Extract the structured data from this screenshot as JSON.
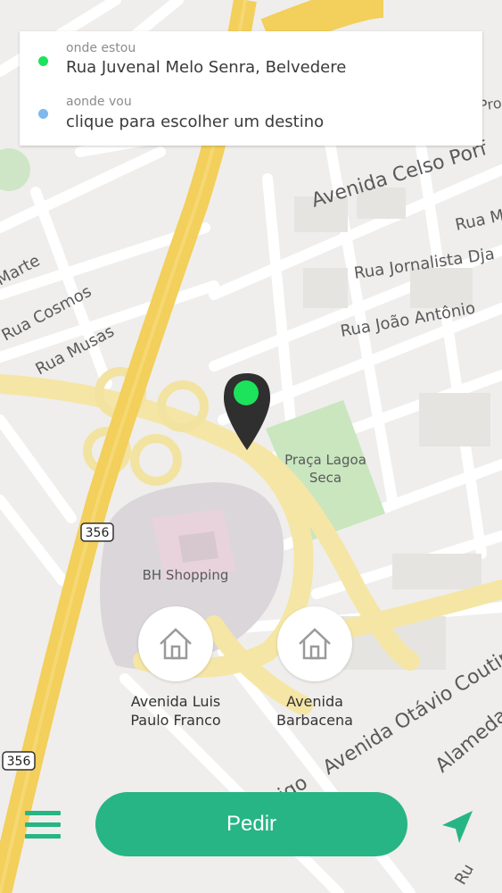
{
  "origin": {
    "caption": "onde estou",
    "value": "Rua Juvenal Melo Senra, Belvedere",
    "dot_color": "#1de25c"
  },
  "destination": {
    "caption": "aonde vou",
    "value": "clique para escolher um destino",
    "dot_color": "#7fb8ec"
  },
  "map": {
    "streets": [
      "Avenida Celso Porf",
      "Rua Jornalista Dja",
      "Rua João Antônio",
      "Rua M",
      "Pro",
      "Marte",
      "Rua Cosmos",
      "Rua Musas",
      "Avenida Otávio Coutinho",
      "igo",
      "Alameda",
      "Ru"
    ],
    "places": {
      "park_line1": "Praça Lagoa",
      "park_line2": "Seca",
      "mall": "BH Shopping"
    },
    "shields": [
      "356",
      "356"
    ],
    "pin_color": "#1de25c"
  },
  "favorites": [
    {
      "line1": "Avenida Luis",
      "line2": "Paulo Franco",
      "icon": "home-icon"
    },
    {
      "line1": "Avenida",
      "line2": "Barbacena",
      "icon": "home-icon"
    }
  ],
  "actions": {
    "request_label": "Pedir",
    "accent_color": "#27b585"
  }
}
